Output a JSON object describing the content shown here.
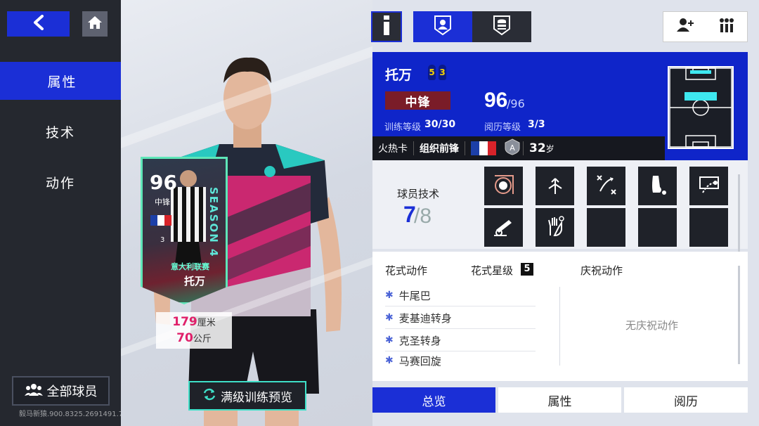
{
  "nav": {
    "back_icon": "chevron-left-icon",
    "home_icon": "home-icon",
    "items": [
      {
        "label": "属性",
        "active": true
      },
      {
        "label": "技术",
        "active": false
      },
      {
        "label": "动作",
        "active": false
      }
    ],
    "all_players_label": "全部球员",
    "watermark": "毅马新猿.900.8325.2691491.7"
  },
  "card": {
    "rating": "96",
    "position": "中锋",
    "number": "3",
    "season": "SEASON 4",
    "league": "意大利联赛",
    "name": "托万",
    "height_value": "179",
    "height_unit": "厘米",
    "weight_value": "70",
    "weight_unit": "公斤"
  },
  "upgrade_button_label": "满级训练预览",
  "top_tabs": {
    "info_icon": "info-icon",
    "player_icon": "player-profile-icon",
    "coins_icon": "coin-stack-icon",
    "compare_icon": "compare-players-icon",
    "stats_icon": "stats-bars-icon"
  },
  "player": {
    "name": "托万",
    "boot_left": "5",
    "boot_right": "3",
    "position": "中锋",
    "ovr": "96",
    "ovr_max": "/96",
    "training_label": "训练等级",
    "training_value": "30/30",
    "experience_label": "阅历等级",
    "experience_value": "3/3",
    "card_type": "火热卡",
    "role": "组织前锋",
    "age": "32",
    "age_unit": "岁",
    "colors": {
      "panel": "#0f25c9",
      "position_badge": "#7a1c28"
    }
  },
  "skills": {
    "label": "球员技术",
    "count": "7",
    "max": "/8",
    "icons": [
      "ball-control-icon",
      "dribble-direction-icon",
      "tactics-icon",
      "boot-kick-icon",
      "free-kick-icon",
      "cannon-shot-icon",
      "goalkeeper-glove-icon"
    ]
  },
  "moves": {
    "fancy_label": "花式动作",
    "star_label": "花式星级",
    "star_value": "5",
    "celebrate_label": "庆祝动作",
    "list": [
      "牛尾巴",
      "麦基迪转身",
      "克圣转身",
      "马赛回旋"
    ],
    "no_celebrate": "无庆祝动作"
  },
  "bottom_tabs": [
    {
      "label": "总览",
      "active": true
    },
    {
      "label": "属性",
      "active": false
    },
    {
      "label": "阅历",
      "active": false
    }
  ]
}
